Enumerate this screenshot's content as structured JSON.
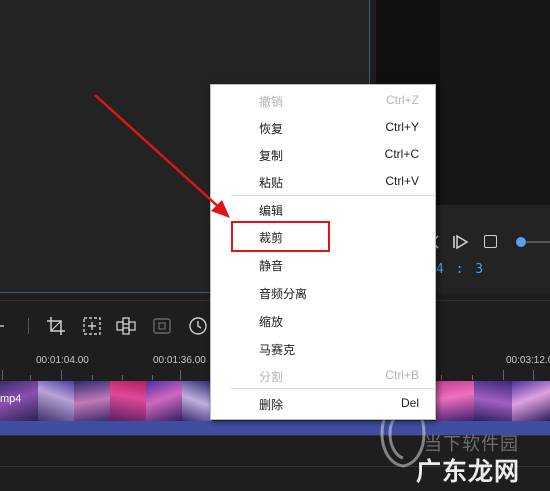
{
  "player": {
    "time_readout": "4 : 3"
  },
  "toolbar": {
    "icons": [
      "crop-icon",
      "zoom-icon",
      "mosaic-icon",
      "freeze-icon",
      "duration-icon"
    ]
  },
  "timeline": {
    "ticks": [
      {
        "label": "00:01:04.00"
      },
      {
        "label": "00:01:36.00"
      },
      {
        "label": "00:03:12.0"
      }
    ],
    "clip_label": "mp4"
  },
  "context_menu": {
    "items": [
      {
        "label": "撤销",
        "shortcut": "Ctrl+Z",
        "enabled": false
      },
      {
        "label": "恢复",
        "shortcut": "Ctrl+Y",
        "enabled": true
      },
      {
        "label": "复制",
        "shortcut": "Ctrl+C",
        "enabled": true
      },
      {
        "label": "粘贴",
        "shortcut": "Ctrl+V",
        "enabled": true
      },
      {
        "label": "编辑",
        "shortcut": "",
        "enabled": true
      },
      {
        "label": "裁剪",
        "shortcut": "",
        "enabled": true
      },
      {
        "label": "静音",
        "shortcut": "",
        "enabled": true
      },
      {
        "label": "音频分离",
        "shortcut": "",
        "enabled": true
      },
      {
        "label": "缩放",
        "shortcut": "",
        "enabled": true
      },
      {
        "label": "马赛克",
        "shortcut": "",
        "enabled": true
      },
      {
        "label": "分割",
        "shortcut": "Ctrl+B",
        "enabled": false
      },
      {
        "label": "删除",
        "shortcut": "Del",
        "enabled": true
      }
    ]
  },
  "watermark": {
    "line1": "当下软件园",
    "line2": "广东龙网"
  },
  "colors": {
    "accent": "#4a9ff0",
    "annotation": "#e01414",
    "clip_bar": "#3f4ea0"
  }
}
